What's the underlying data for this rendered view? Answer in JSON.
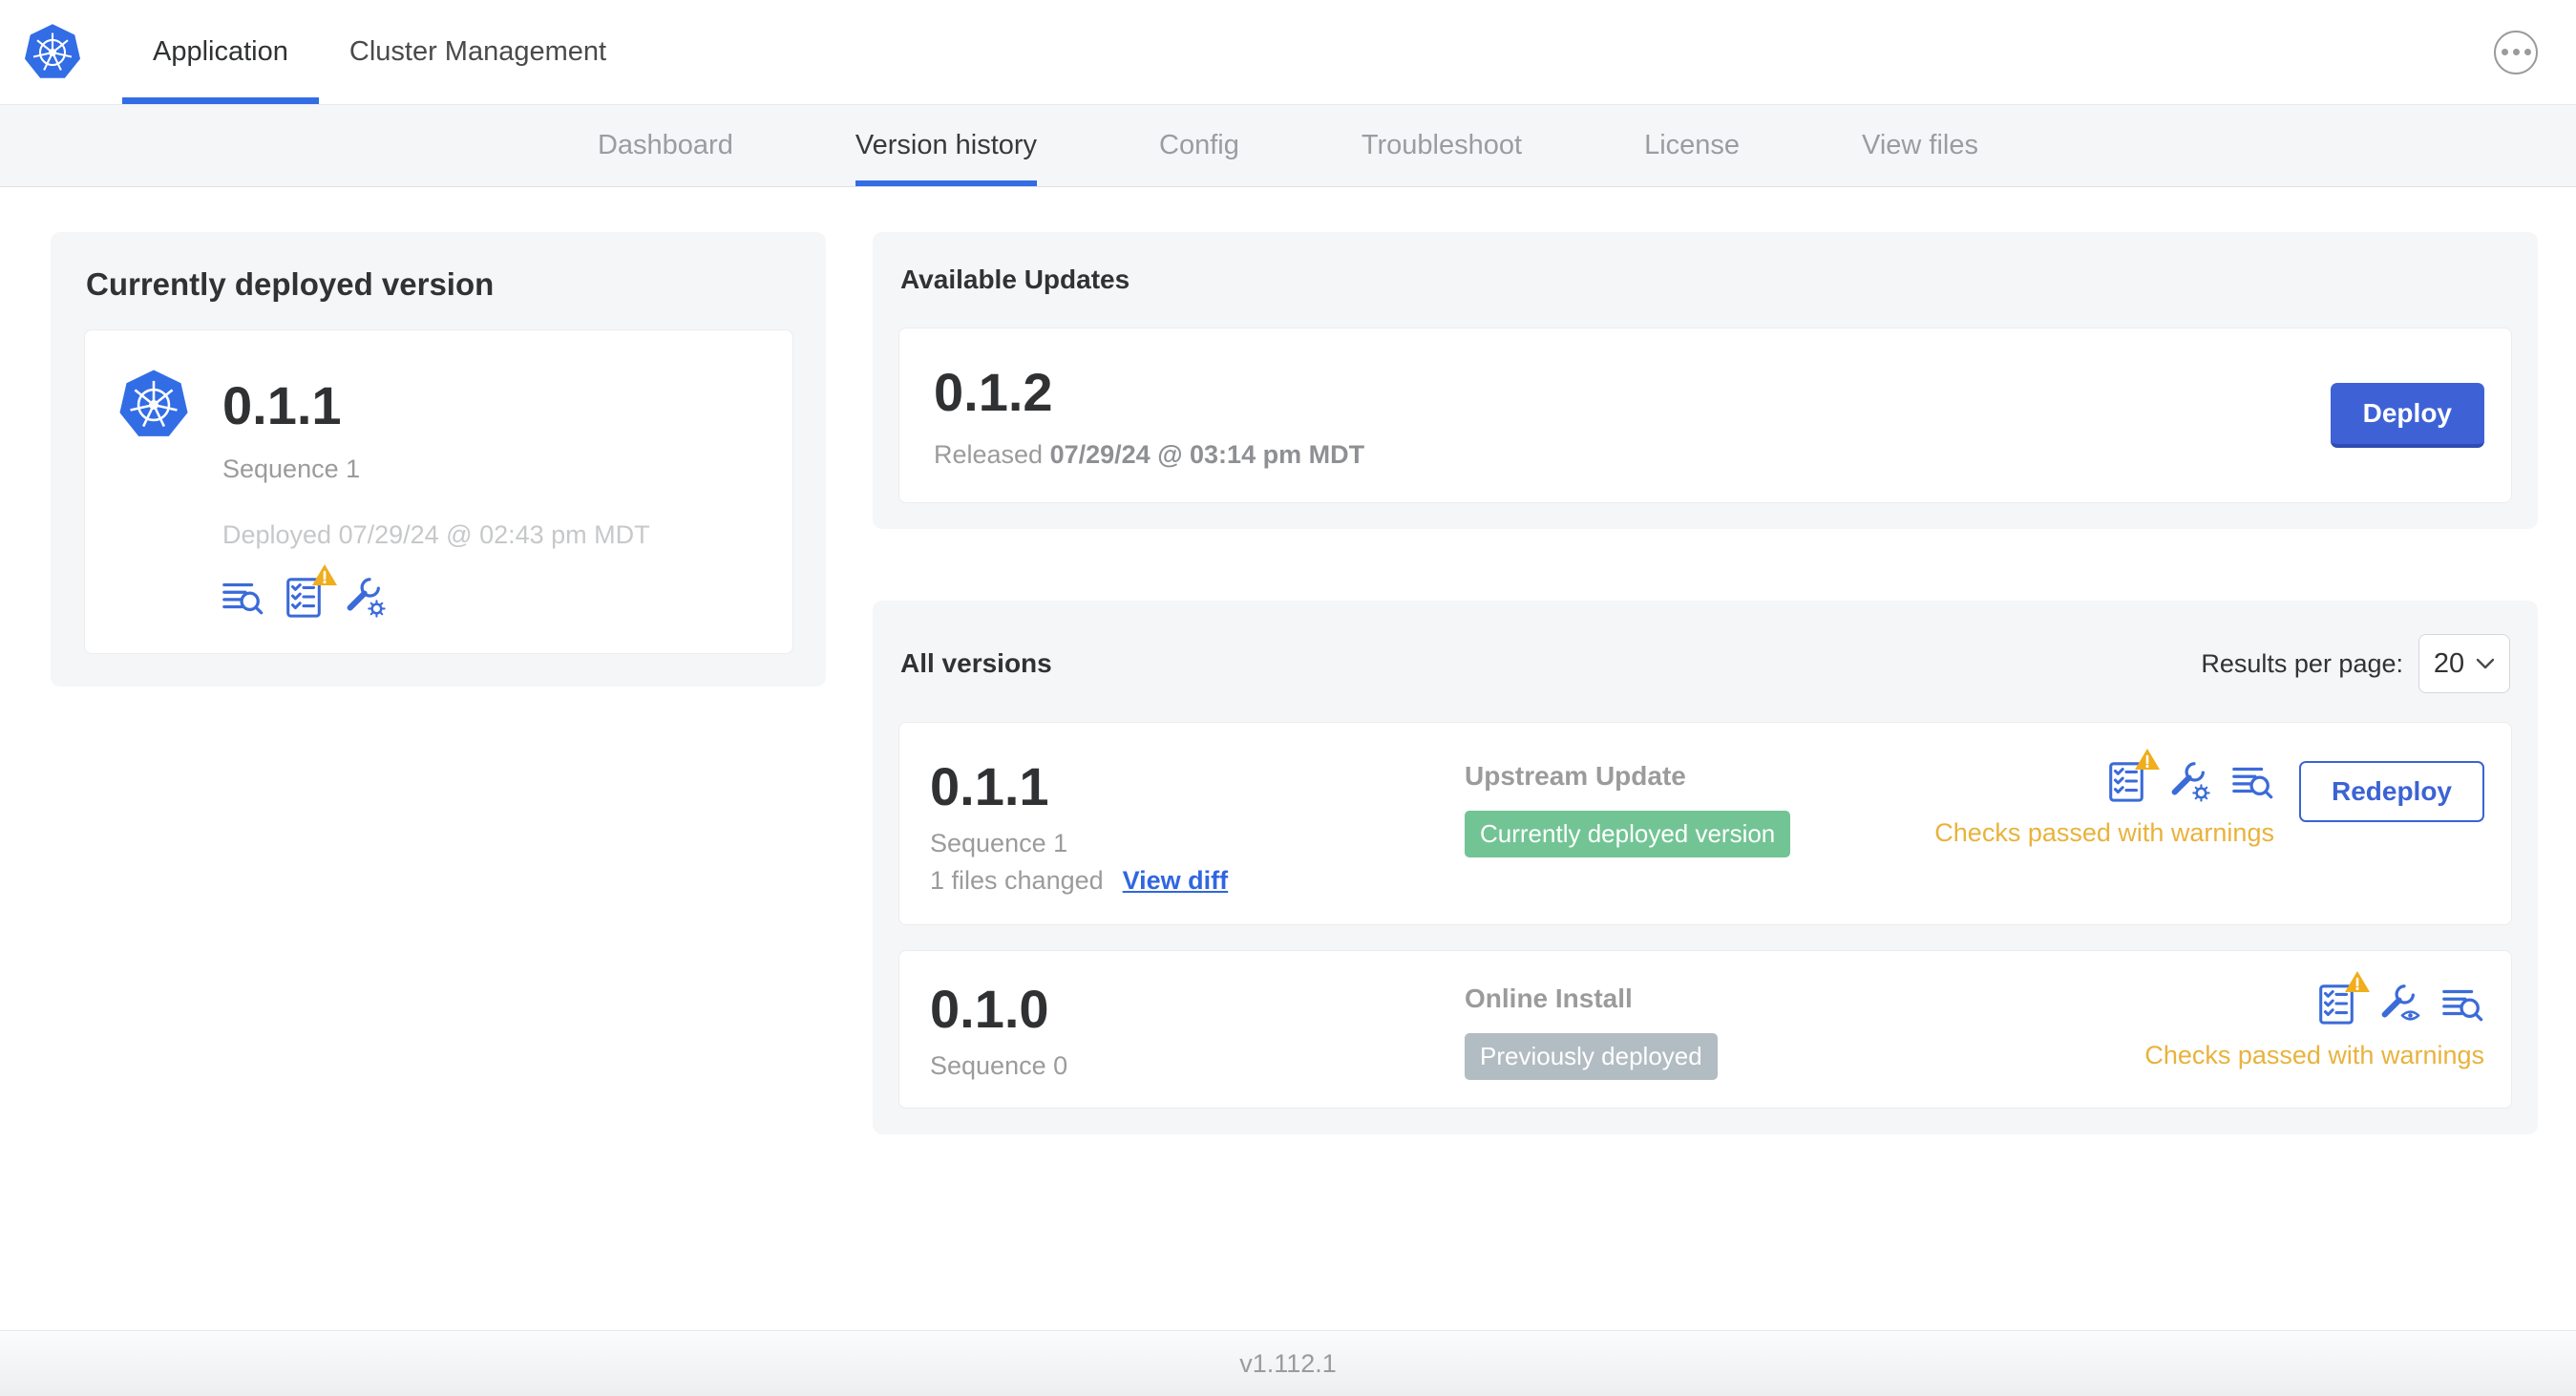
{
  "colors": {
    "accent_blue": "#326de6",
    "button_blue": "#3e62d6",
    "link_blue": "#3066e0",
    "icon_blue": "#3b6bd8",
    "warning_orange": "#e9b23c",
    "warning_triangle": "#f0ad1c",
    "success_green": "#72c494",
    "neutral_badge_gray": "#b2bcc3"
  },
  "topnav": {
    "tabs": [
      {
        "label": "Application"
      },
      {
        "label": "Cluster Management"
      }
    ]
  },
  "subnav": {
    "tabs": [
      "Dashboard",
      "Version history",
      "Config",
      "Troubleshoot",
      "License",
      "View files"
    ]
  },
  "current_version": {
    "title": "Currently deployed version",
    "version": "0.1.1",
    "sequence": "Sequence 1",
    "deployed_at": "Deployed 07/29/24 @ 02:43 pm MDT"
  },
  "available_updates": {
    "title": "Available Updates",
    "version": "0.1.2",
    "released_label": "Released",
    "released_at": "07/29/24 @ 03:14 pm MDT",
    "deploy_button": "Deploy"
  },
  "all_versions": {
    "title": "All versions",
    "results_per_page_label": "Results per page:",
    "results_per_page": "20",
    "rows": [
      {
        "version": "0.1.1",
        "sequence": "Sequence 1",
        "files_changed": "1 files changed",
        "view_diff_link": "View diff",
        "source_type": "Upstream Update",
        "badge": "Currently deployed version",
        "status": "Checks passed with warnings",
        "redeploy_button": "Redeploy"
      },
      {
        "version": "0.1.0",
        "sequence": "Sequence 0",
        "source_type": "Online Install",
        "badge": "Previously deployed",
        "status": "Checks passed with warnings"
      }
    ]
  },
  "footer": {
    "version": "v1.112.1"
  }
}
